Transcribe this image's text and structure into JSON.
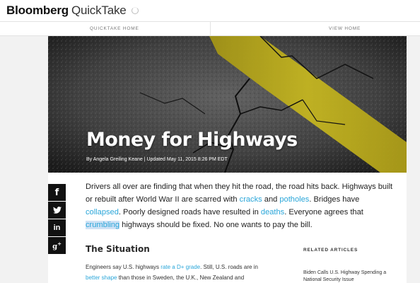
{
  "header": {
    "brand_primary": "Bloomberg",
    "brand_secondary": "QuickTake"
  },
  "nav": {
    "left_label": "QUICKTAKE HOME",
    "right_label": "VIEW HOME"
  },
  "hero": {
    "title": "Money for Highways",
    "byline": "By Angela Greiling Keane | Updated May 11, 2015 8:26 PM EDT"
  },
  "share": {
    "icons": [
      "facebook-icon",
      "twitter-icon",
      "linkedin-icon",
      "google-plus-icon"
    ]
  },
  "intro": {
    "t1": "Drivers all over are finding that when they hit the road, the road hits back. Highways built or rebuilt after World War II are scarred with ",
    "link_cracks": "cracks",
    "t2": " and ",
    "link_potholes": "potholes",
    "t3": ". Bridges have ",
    "link_collapsed": "collapsed",
    "t4": ". Poorly designed roads have resulted in ",
    "link_deaths": "deaths",
    "t5": ". Everyone agrees that ",
    "link_crumbling": "crumbling",
    "t6": " highways should be fixed. No one wants to pay the bill."
  },
  "situation": {
    "title": "The Situation",
    "t1": "Engineers say U.S. highways ",
    "link_grade": "rate a D+ grade",
    "t2": ". Still, U.S. roads are in ",
    "link_shape": "better shape",
    "t3": " than those in Sweden, the U.K., New Zealand and"
  },
  "related": {
    "label": "RELATED ARTICLES",
    "items": [
      "Biden Calls U.S. Highway Spending a National Security Issue"
    ]
  },
  "colors": {
    "link": "#2aa6d9",
    "highlight": "#cfe2f5",
    "share_bg": "#111111"
  }
}
